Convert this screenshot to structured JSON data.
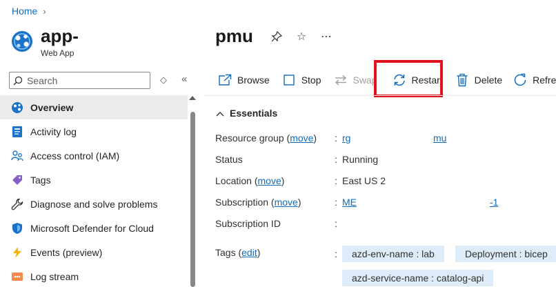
{
  "breadcrumb": {
    "home": "Home"
  },
  "app": {
    "name": "app-",
    "type": "Web App"
  },
  "page": {
    "title": "pmu"
  },
  "search": {
    "placeholder": "Search"
  },
  "sidebar": {
    "items": [
      {
        "label": "Overview",
        "icon": "web-app-icon"
      },
      {
        "label": "Activity log",
        "icon": "activity-log-icon"
      },
      {
        "label": "Access control (IAM)",
        "icon": "people-icon"
      },
      {
        "label": "Tags",
        "icon": "tag-icon"
      },
      {
        "label": "Diagnose and solve problems",
        "icon": "wrench-icon"
      },
      {
        "label": "Microsoft Defender for Cloud",
        "icon": "shield-icon"
      },
      {
        "label": "Events (preview)",
        "icon": "lightning-icon"
      },
      {
        "label": "Log stream",
        "icon": "log-stream-icon"
      }
    ]
  },
  "toolbar": {
    "browse": "Browse",
    "stop": "Stop",
    "swap": "Swap",
    "restart": "Restart",
    "delete": "Delete",
    "refresh": "Refresh"
  },
  "essentials": {
    "heading": "Essentials",
    "move_link": "move",
    "edit_link": "edit",
    "resource_group_label": "Resource group",
    "resource_group_value_a": "rg",
    "resource_group_value_b": "mu",
    "status_label": "Status",
    "status_value": "Running",
    "location_label": "Location",
    "location_value": "East US 2",
    "subscription_label": "Subscription",
    "subscription_value_a": "ME",
    "subscription_value_b": "-1",
    "subscription_id_label": "Subscription ID",
    "tags_label": "Tags",
    "tags": [
      "azd-env-name : lab",
      "Deployment : bicep",
      "azd-service-name : catalog-api"
    ]
  },
  "colors": {
    "link": "#0f6cbd",
    "highlight": "#e3111b",
    "tag_bg": "#deecf9",
    "active_bg": "#edebe9"
  }
}
